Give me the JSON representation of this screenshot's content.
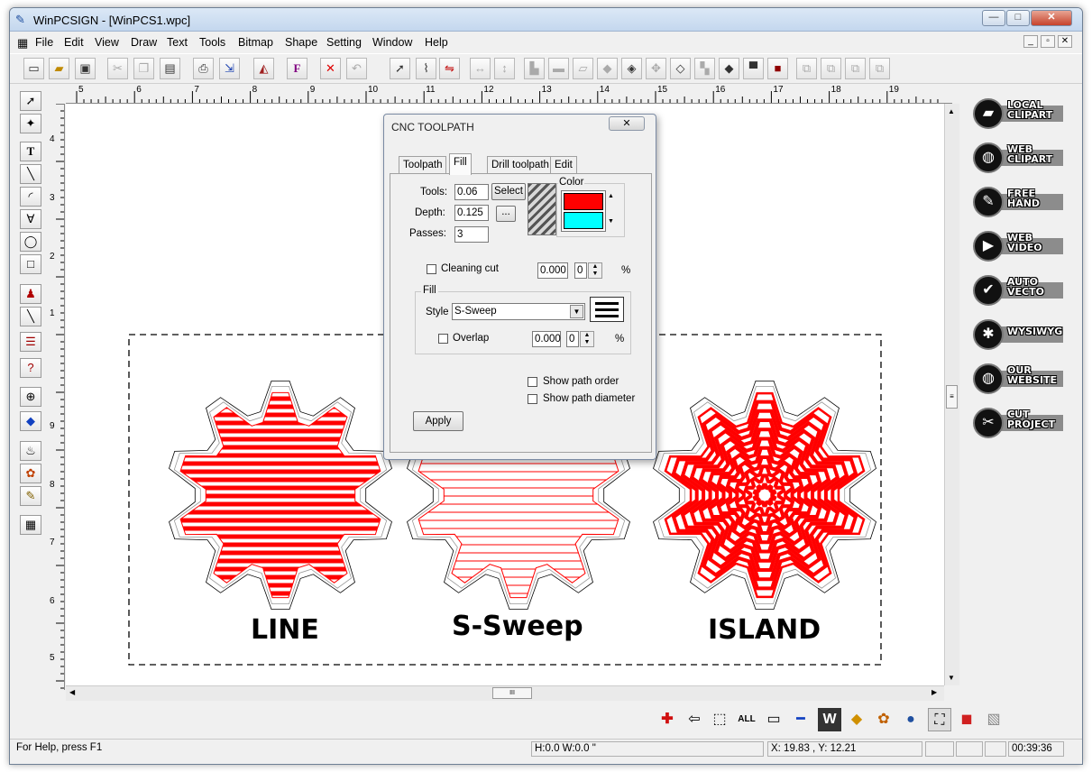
{
  "titlebar": {
    "title": "WinPCSIGN - [WinPCS1.wpc]",
    "min": "—",
    "max": "□",
    "close": "✕"
  },
  "menubar": {
    "items": [
      "File",
      "Edit",
      "View",
      "Draw",
      "Text",
      "Tools",
      "Bitmap",
      "Shape",
      "Setting",
      "Window",
      "Help"
    ]
  },
  "toolbar": {
    "icons": [
      "new-icon",
      "open-icon",
      "save-icon",
      "cut-icon",
      "copy-icon",
      "paste-icon",
      "print-icon",
      "import-icon",
      "eraser-icon",
      "font-icon",
      "delete-icon",
      "undo-icon",
      "select-icon",
      "node-icon",
      "transform-icon",
      "hflip-icon",
      "vflip-icon"
    ]
  },
  "ruler": {
    "h": [
      "5",
      "6",
      "7",
      "8",
      "9",
      "10",
      "11",
      "12",
      "13",
      "14",
      "15",
      "16",
      "17",
      "18",
      "19"
    ],
    "v": [
      "4",
      "3",
      "2",
      "1",
      "9",
      "8",
      "7",
      "6",
      "5"
    ]
  },
  "dialog": {
    "title": "CNC TOOLPATH",
    "tabs": [
      "Toolpath",
      "Fill",
      "Drill toolpath",
      "Edit"
    ],
    "tools_label": "Tools:",
    "tools_value": "0.06",
    "select_button": "Select",
    "depth_label": "Depth:",
    "depth_value": "0.125",
    "ellipsis_button": "...",
    "passes_label": "Passes:",
    "passes_value": "3",
    "color_label": "Color",
    "colors": [
      "#ff0000",
      "#00ffff"
    ],
    "cleaning_label": "Cleaning cut",
    "cleaning_value": "0.000",
    "cleaning_count": "0",
    "pct": "%",
    "fill_group": "Fill",
    "style_label": "Style",
    "style_value": "S-Sweep",
    "overlap_label": "Overlap",
    "overlap_value": "0.000",
    "overlap_count": "0",
    "show_order": "Show path order",
    "show_diameter": "Show path diameter",
    "apply_button": "Apply"
  },
  "canvas": {
    "labels": [
      "LINE",
      "S-Sweep",
      "ISLAND"
    ]
  },
  "rightpanel": [
    {
      "label": "LOCAL CLIPART",
      "icon": "folder-icon"
    },
    {
      "label": "WEB CLIPART",
      "icon": "globe-icon"
    },
    {
      "label": "FREE HAND",
      "icon": "pen-icon"
    },
    {
      "label": "WEB VIDEO",
      "icon": "video-icon"
    },
    {
      "label": "AUTO VECTO",
      "icon": "check-icon"
    },
    {
      "label": "WYSIWYG",
      "icon": "gear-icon"
    },
    {
      "label": "OUR WEBSITE",
      "icon": "globe-icon"
    },
    {
      "label": "CUT PROJECT",
      "icon": "cut-icon"
    }
  ],
  "statusbar": {
    "help": "For Help, press F1",
    "size": "H:0.0  W:0.0 \"",
    "coords": "X: 19.83 , Y: 12.21",
    "time": "00:39:36"
  },
  "hscroll": {
    "thumb": "III"
  }
}
